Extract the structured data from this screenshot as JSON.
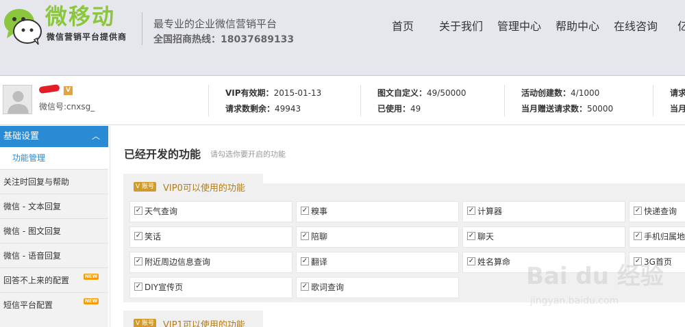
{
  "header": {
    "logo_title": "微移动",
    "logo_sub": "微信营销平台提供商",
    "slogan": "最专业的企业微信营销平台",
    "hotline": "全国招商热线：18037689133",
    "nav": [
      "首页",
      "关于我们",
      "管理中心",
      "帮助中心",
      "在线咨询",
      "亿"
    ]
  },
  "account": {
    "username": "~",
    "vip_icon": "V",
    "wechat_id": "微信号:cnxsg_",
    "stats": [
      {
        "label": "VIP有效期：",
        "value": "2015-01-13"
      },
      {
        "label": "请求数剩余：",
        "value": "49943"
      },
      {
        "label": "图文自定义：",
        "value": "49/50000"
      },
      {
        "label": "已使用：",
        "value": "49"
      },
      {
        "label": "活动创建数：",
        "value": "4/1000"
      },
      {
        "label": "当月赠送请求数：",
        "value": "50000"
      },
      {
        "label": "请求",
        "value": ""
      },
      {
        "label": "当月",
        "value": ""
      }
    ]
  },
  "sidebar": {
    "section_title": "基础设置",
    "sub_active": "功能管理",
    "items": [
      {
        "label": "关注时回复与帮助",
        "badge": ""
      },
      {
        "label": "微信 - 文本回复",
        "badge": ""
      },
      {
        "label": "微信 - 图文回复",
        "badge": ""
      },
      {
        "label": "微信 - 语音回复",
        "badge": ""
      },
      {
        "label": "回答不上来的配置",
        "badge": "NEW"
      },
      {
        "label": "短信平台配置",
        "badge": "NEW"
      }
    ]
  },
  "main": {
    "title": "已经开发的功能",
    "hint": "请勾选你要开启的功能",
    "vip0_badge": "V 账号",
    "vip0_label": "VIP0可以使用的功能",
    "vip1_badge": "V 账号",
    "vip1_label": "VIP1可以使用的功能",
    "features": [
      "天气查询",
      "糗事",
      "计算器",
      "快递查询",
      "笑话",
      "陪聊",
      "聊天",
      "手机归属地",
      "附近周边信息查询",
      "翻译",
      "姓名算命",
      "3G首页",
      "DIY宣传页",
      "歌词查询"
    ]
  },
  "watermark": {
    "text": "Bai du 经验",
    "url": "jingyan.baidu.com"
  }
}
